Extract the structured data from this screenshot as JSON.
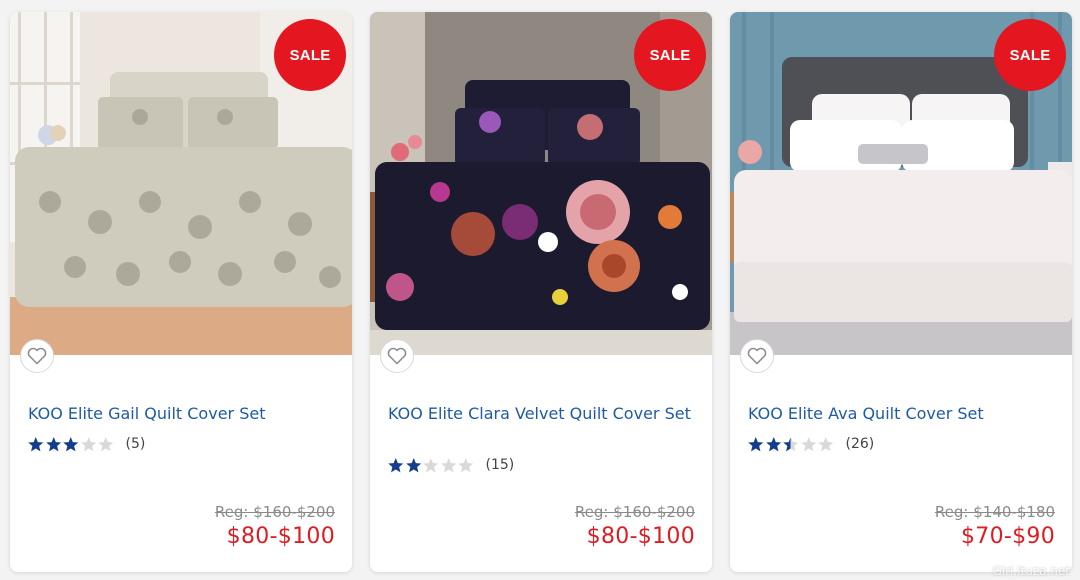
{
  "products": [
    {
      "badge": "SALE",
      "title": "KOO Elite Gail Quilt Cover Set",
      "rating_count": "(5)",
      "reg_price": "Reg: $160-$200",
      "sale_price": "$80-$100",
      "stars_filled": 3,
      "stars_total": 5
    },
    {
      "badge": "SALE",
      "title": "KOO Elite Clara Velvet Quilt Cover Set",
      "rating_count": "(15)",
      "reg_price": "Reg: $160-$200",
      "sale_price": "$80-$100",
      "stars_filled": 2,
      "stars_total": 5
    },
    {
      "badge": "SALE",
      "title": "KOO Elite Ava Quilt Cover Set",
      "rating_count": "(26)",
      "reg_price": "Reg: $140-$180",
      "sale_price": "$70-$90",
      "stars_filled": 2.5,
      "stars_total": 5
    }
  ],
  "watermark": "Girl.ituza.net",
  "colors": {
    "sale_badge": "#e4161f",
    "title_link": "#1f5aa6",
    "star_filled": "#143d8c",
    "star_empty": "#d9d9d9",
    "sale_price": "#e01b22",
    "reg_price": "#8a8a8a"
  },
  "icons": {
    "favorite": "heart-outline-icon",
    "rating": "star-icon"
  }
}
